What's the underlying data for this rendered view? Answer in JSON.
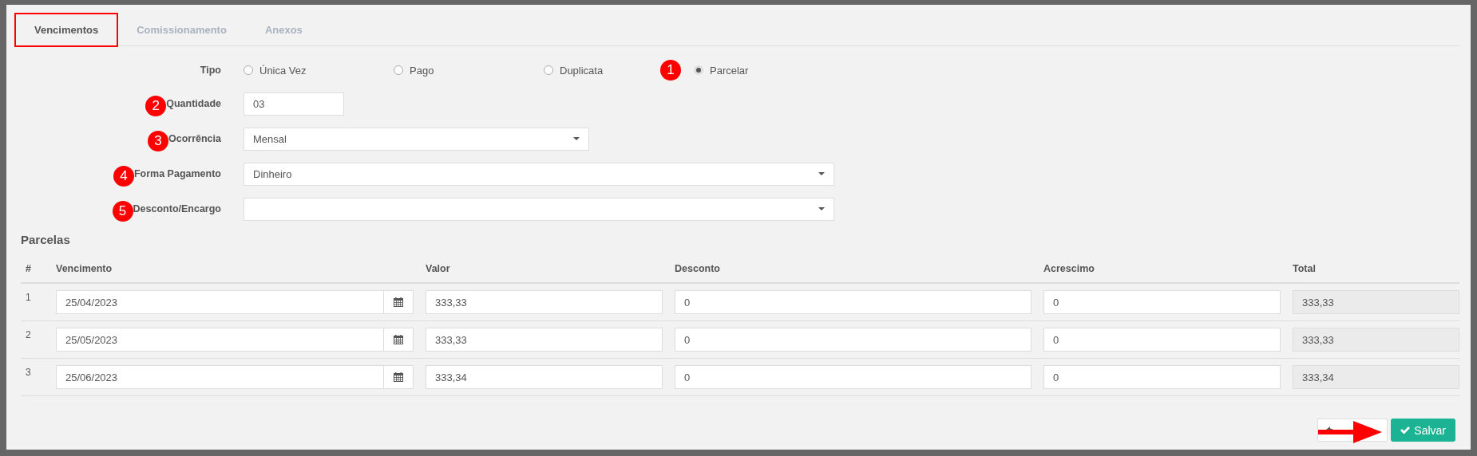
{
  "tabs": [
    {
      "label": "Vencimentos",
      "selected": true,
      "highlighted": true
    },
    {
      "label": "Comissionamento",
      "selected": false,
      "highlighted": false
    },
    {
      "label": "Anexos",
      "selected": false,
      "highlighted": false
    }
  ],
  "tipo": {
    "label": "Tipo",
    "badge": "1",
    "options": [
      {
        "label": "Única Vez",
        "selected": false
      },
      {
        "label": "Pago",
        "selected": false
      },
      {
        "label": "Duplicata",
        "selected": false
      },
      {
        "label": "Parcelar",
        "selected": true
      }
    ]
  },
  "fields": [
    {
      "label": "Quantidade",
      "badge": "2",
      "kind": "text",
      "value": "03"
    },
    {
      "label": "Ocorrência",
      "badge": "3",
      "kind": "select",
      "value": "Mensal"
    },
    {
      "label": "Forma Pagamento",
      "badge": "4",
      "kind": "select",
      "value": "Dinheiro"
    },
    {
      "label": "Desconto/Encargo",
      "badge": "5",
      "kind": "select"
    }
  ],
  "parcelas": {
    "title": "Parcelas",
    "columns": [
      "#",
      "Vencimento",
      "Valor",
      "Desconto",
      "Acrescimo",
      "Total"
    ],
    "rows": [
      {
        "number": "1",
        "vencimento": "25/04/2023",
        "valor": "333,33",
        "desconto": "0",
        "acrescimo": "0",
        "total": "333,33"
      },
      {
        "number": "2",
        "vencimento": "25/05/2023",
        "valor": "333,33",
        "desconto": "0",
        "acrescimo": "0",
        "total": "333,33"
      },
      {
        "number": "3",
        "vencimento": "25/06/2023",
        "valor": "333,34",
        "desconto": "0",
        "acrescimo": "0",
        "total": "333,34"
      }
    ]
  },
  "buttons": [
    {
      "kind": "cancel",
      "covered": true
    },
    {
      "kind": "save",
      "label": "Salvar"
    }
  ]
}
